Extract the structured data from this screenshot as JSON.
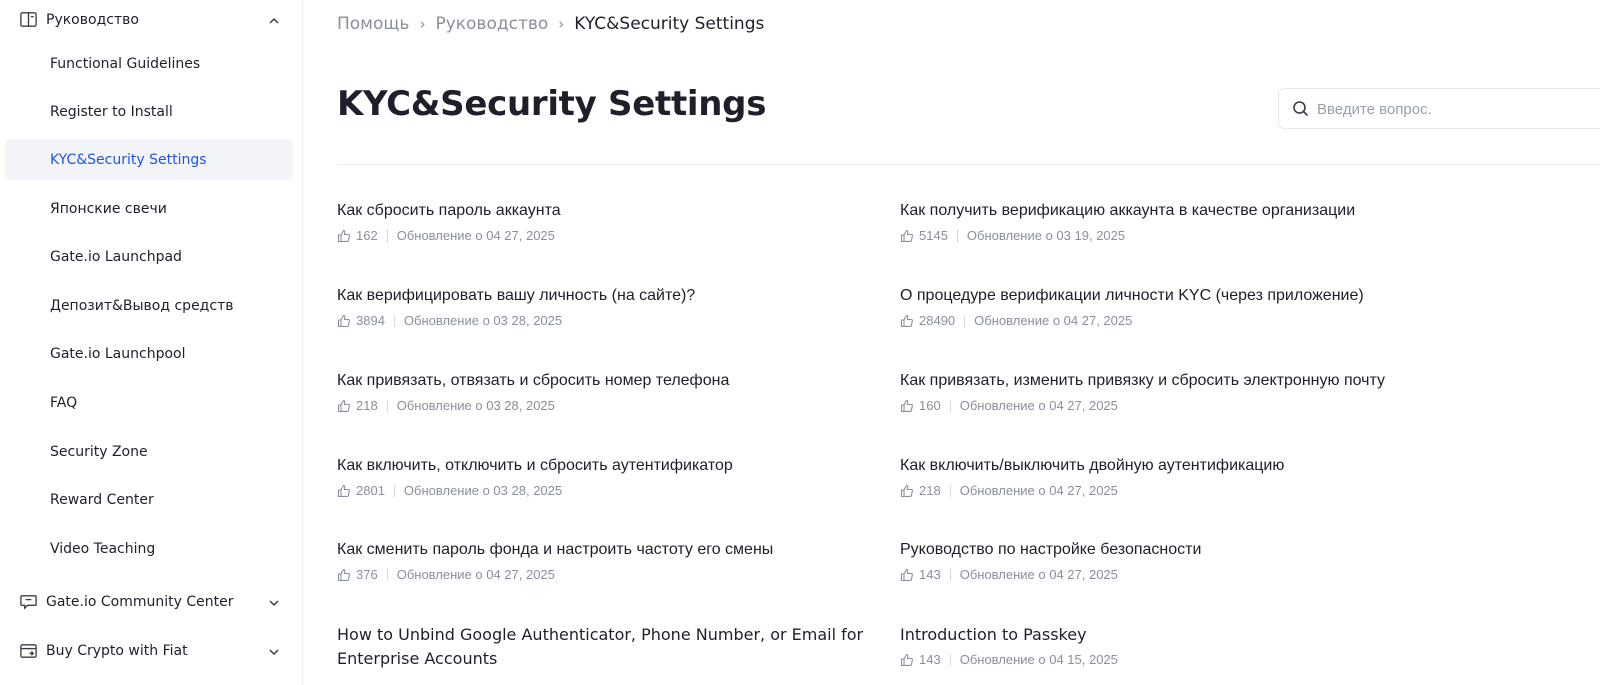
{
  "sidebar": {
    "guide_section": {
      "label": "Руководство"
    },
    "items": [
      {
        "label": "Functional Guidelines"
      },
      {
        "label": "Register to Install"
      },
      {
        "label": "KYC&Security Settings"
      },
      {
        "label": "Японские свечи"
      },
      {
        "label": "Gate.io Launchpad"
      },
      {
        "label": "Депозит&Вывод средств"
      },
      {
        "label": "Gate.io Launchpool"
      },
      {
        "label": "FAQ"
      },
      {
        "label": "Security Zone"
      },
      {
        "label": "Reward Center"
      },
      {
        "label": "Video Teaching"
      }
    ],
    "community_section": {
      "label": "Gate.io Community Center"
    },
    "fiat_section": {
      "label": "Buy Crypto with Fiat"
    },
    "active_index": 2
  },
  "breadcrumb": {
    "items": [
      "Помощь",
      "Руководство"
    ],
    "current": "KYC&Security Settings"
  },
  "page": {
    "title": "KYC&Security Settings"
  },
  "search": {
    "placeholder": "Введите вопрос.",
    "value": ""
  },
  "articles": [
    {
      "title": "Как сбросить пароль аккаунта",
      "likes": "162",
      "updated": "Обновление о 04 27, 2025"
    },
    {
      "title": "Как получить верификацию аккаунта в качестве организации",
      "likes": "5145",
      "updated": "Обновление о 03 19, 2025"
    },
    {
      "title": "Как верифицировать вашу личность (на сайте)?",
      "likes": "3894",
      "updated": "Обновление о 03 28, 2025"
    },
    {
      "title": "О процедуре верификации личности KYC (через приложение)",
      "likes": "28490",
      "updated": "Обновление о 04 27, 2025"
    },
    {
      "title": "Как привязать, отвязать и сбросить номер телефона",
      "likes": "218",
      "updated": "Обновление о 03 28, 2025"
    },
    {
      "title": "Как привязать, изменить привязку и сбросить электронную почту",
      "likes": "160",
      "updated": "Обновление о 04 27, 2025"
    },
    {
      "title": "Как включить, отключить и сбросить аутентификатор",
      "likes": "2801",
      "updated": "Обновление о 03 28, 2025"
    },
    {
      "title": "Как включить/выключить двойную аутентификацию",
      "likes": "218",
      "updated": "Обновление о 04 27, 2025"
    },
    {
      "title": "Как сменить пароль фонда и настроить частоту его смены",
      "likes": "376",
      "updated": "Обновление о 04 27, 2025"
    },
    {
      "title": "Руководство по настройке безопасности",
      "likes": "143",
      "updated": "Обновление о 04 27, 2025"
    },
    {
      "title": "How to Unbind Google Authenticator, Phone Number, or Email for Enterprise Accounts",
      "likes": "",
      "updated": ""
    },
    {
      "title": "Introduction to Passkey",
      "likes": "143",
      "updated": "Обновление о 04 15, 2025"
    }
  ],
  "icons": {
    "guide": "book-icon",
    "community": "chat-icon",
    "fiat": "wallet-icon",
    "search": "search-icon",
    "like": "thumbs-up-icon"
  },
  "colors": {
    "accent": "#2354e6",
    "active_bg": "#f3f4f7",
    "muted": "#8a8f9c"
  }
}
